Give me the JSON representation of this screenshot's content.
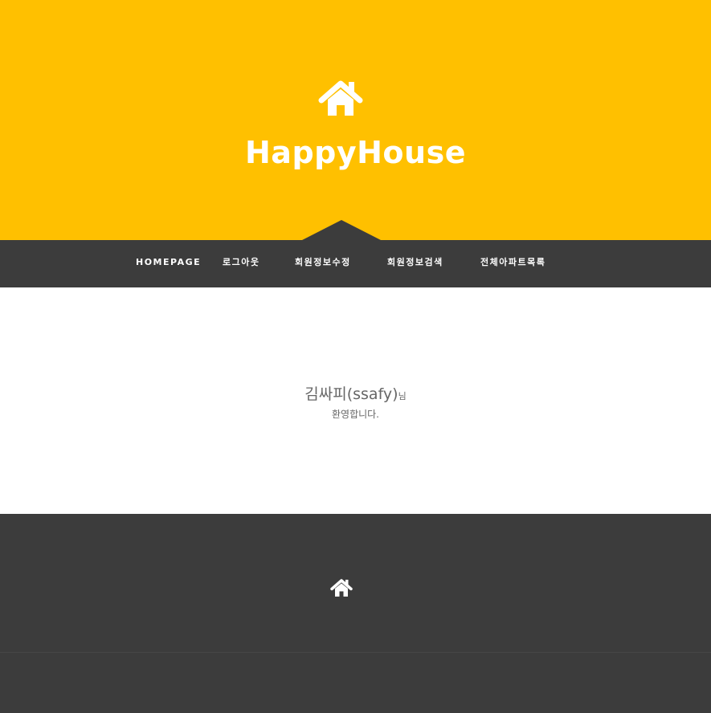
{
  "header": {
    "icon": "home-icon",
    "title": "HappyHouse",
    "background_color": "#ffc000"
  },
  "nav": {
    "background_color": "#3c3c3c",
    "items": [
      {
        "label": "HOMEPAGE"
      },
      {
        "label": "로그아웃"
      },
      {
        "label": "회원정보수정"
      },
      {
        "label": "회원정보검색"
      },
      {
        "label": "전체아파트목록"
      }
    ]
  },
  "main": {
    "user_display": "김싸피(ssafy)",
    "honorific": "님",
    "welcome_message": "환영합니다."
  },
  "footer": {
    "icon": "home-icon",
    "background_color": "#3c3c3c"
  }
}
